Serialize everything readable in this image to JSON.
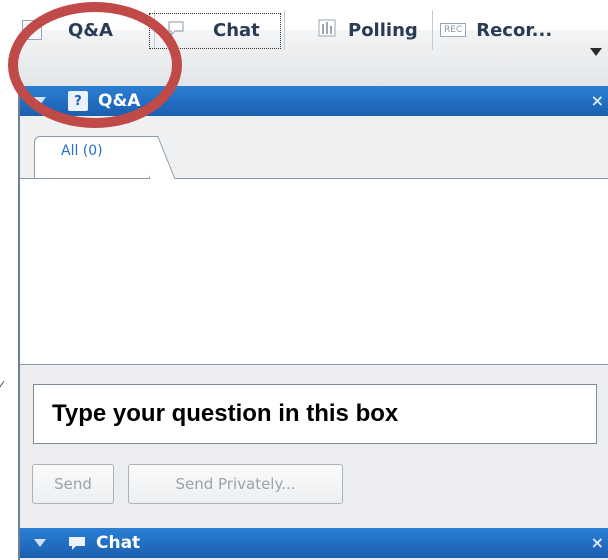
{
  "tabs": [
    {
      "label": "Q&A",
      "icon": "question-icon",
      "icon_glyph": "?"
    },
    {
      "label": "Chat",
      "icon": "chat-bubble-icon"
    },
    {
      "label": "Polling",
      "icon": "polling-icon"
    },
    {
      "label": "Recor...",
      "icon": "record-icon",
      "icon_glyph": "REC"
    }
  ],
  "qa_panel": {
    "title": "Q&A",
    "icon_glyph": "?",
    "close_glyph": "×",
    "subtab_label": "All (0)",
    "question_box_text": "Type your question in this box",
    "send_label": "Send",
    "send_private_label": "Send Privately..."
  },
  "chat_panel": {
    "title": "Chat",
    "close_glyph": "×"
  },
  "colors": {
    "header_blue": "#1b5fb0",
    "annotation_ring": "#c04a48",
    "tab_text": "#2a3b55"
  }
}
